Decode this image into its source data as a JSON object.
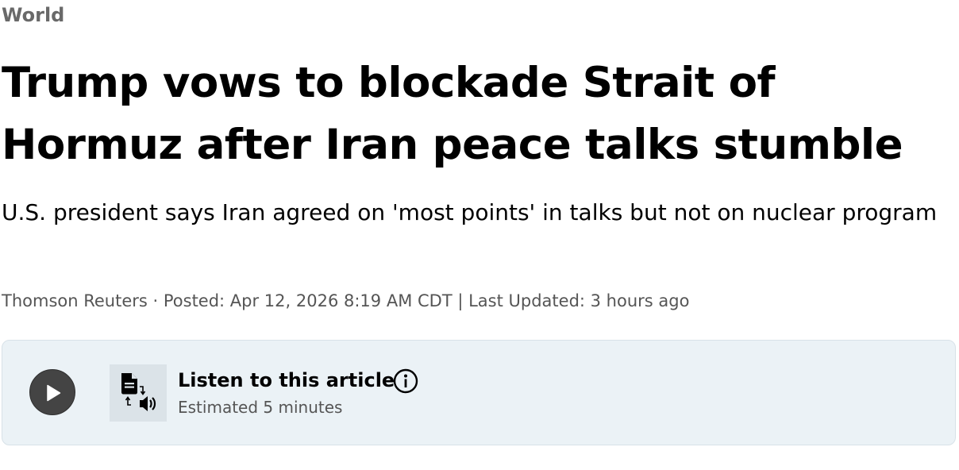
{
  "article": {
    "section": "World",
    "headline": "Trump vows to blockade Strait of Hormuz after Iran peace talks stumble",
    "deck": "U.S. president says Iran agreed on 'most points' in talks but not on nuclear program",
    "byline": {
      "author": "Thomson Reuters",
      "separator": " · ",
      "posted": "Posted: Apr 12, 2026 8:19 AM CDT",
      "divider": " | ",
      "updated": "Last Updated: 3 hours ago"
    }
  },
  "audio_player": {
    "title": "Listen to this article",
    "duration": "Estimated 5 minutes",
    "play_icon": "play-icon",
    "text_to_speech_icon": "text-to-speech-icon",
    "info_icon": "info-icon",
    "colors": {
      "background": "#ebf2f6",
      "play_button": "#444444",
      "icon_tile": "#dbe3e8"
    }
  }
}
